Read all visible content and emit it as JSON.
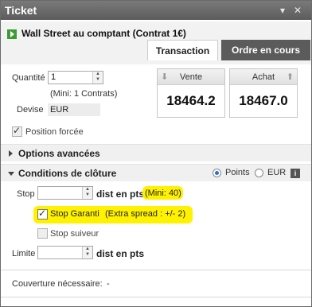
{
  "window": {
    "title": "Ticket"
  },
  "product": {
    "name": "Wall Street au comptant (Contrat 1€)"
  },
  "tabs": [
    {
      "label": "Transaction",
      "active": true
    },
    {
      "label": "Ordre en cours",
      "active": false
    }
  ],
  "order": {
    "quantity_label": "Quantité",
    "quantity_value": "1",
    "min_note": "(Mini: 1 Contrats)",
    "devise_label": "Devise",
    "devise_value": "EUR"
  },
  "prices": {
    "sell_label": "Vente",
    "sell_value": "18464.2",
    "buy_label": "Achat",
    "buy_value": "18467.0"
  },
  "forced_position": {
    "label": "Position forcée",
    "checked": true
  },
  "sections": {
    "advanced": "Options avancées",
    "closing": "Conditions de clôture"
  },
  "unit_toggle": {
    "points_label": "Points",
    "eur_label": "EUR",
    "selected": "Points"
  },
  "stop": {
    "label": "Stop",
    "value": "",
    "unit": "dist en pts",
    "min_note": "(Mini: 40)"
  },
  "guaranteed_stop": {
    "label": "Stop Garanti",
    "note": "(Extra spread : +/- 2)",
    "checked": true
  },
  "trailing_stop": {
    "label": "Stop suiveur",
    "checked": false
  },
  "limit": {
    "label": "Limite",
    "value": "",
    "unit": "dist en pts"
  },
  "coverage": {
    "label": "Couverture nécessaire:",
    "value": "-"
  },
  "colors": {
    "highlight": "#fff200",
    "title_bar": "#666666",
    "accent_green": "#3d9b35",
    "inactive_tab": "#5b5b5b"
  }
}
